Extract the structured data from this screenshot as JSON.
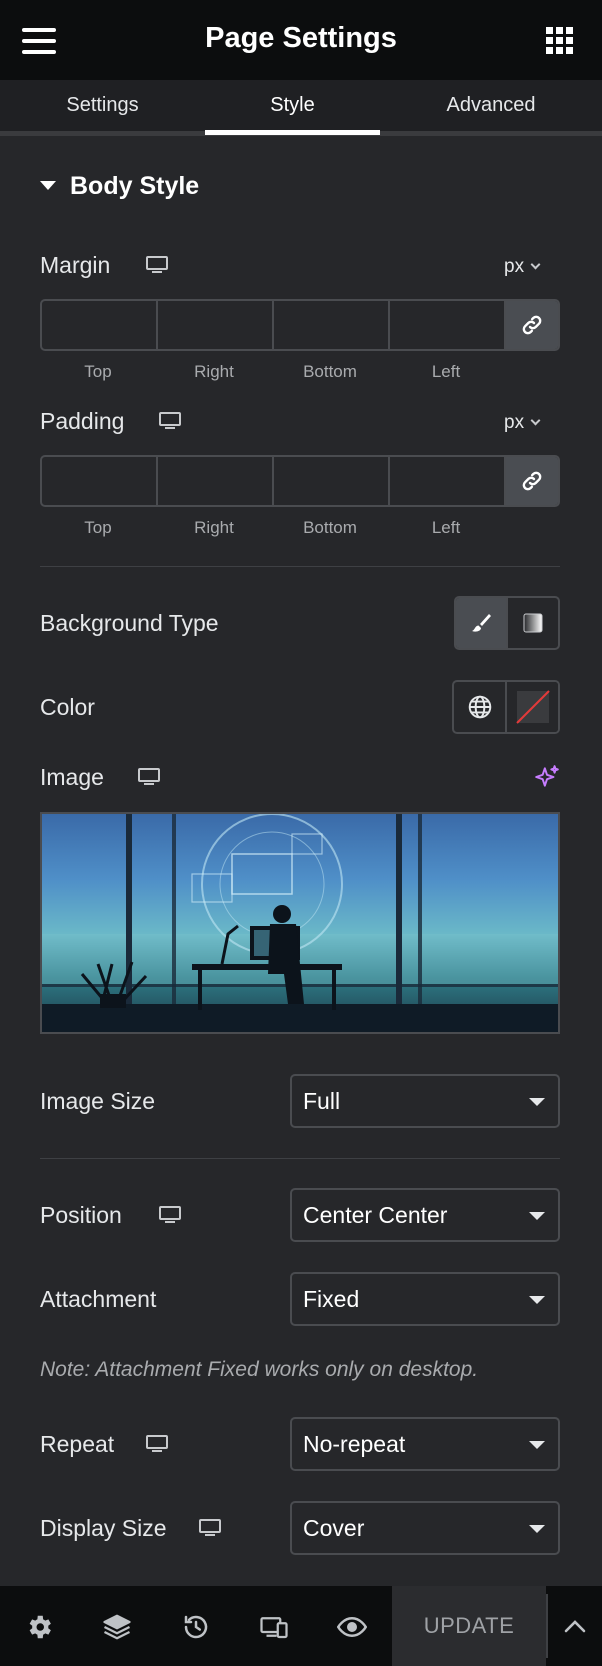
{
  "header": {
    "title": "Page Settings",
    "menu_icon": "hamburger-icon",
    "apps_icon": "grid-icon"
  },
  "tabs": [
    {
      "label": "Settings",
      "active": false
    },
    {
      "label": "Style",
      "active": true
    },
    {
      "label": "Advanced",
      "active": false
    }
  ],
  "section": {
    "title": "Body Style"
  },
  "margin": {
    "label": "Margin",
    "unit": "px",
    "values": {
      "top": "",
      "right": "",
      "bottom": "",
      "left": ""
    },
    "sides": [
      "Top",
      "Right",
      "Bottom",
      "Left"
    ]
  },
  "padding": {
    "label": "Padding",
    "unit": "px",
    "values": {
      "top": "",
      "right": "",
      "bottom": "",
      "left": ""
    },
    "sides": [
      "Top",
      "Right",
      "Bottom",
      "Left"
    ]
  },
  "background_type": {
    "label": "Background Type",
    "selected": "classic"
  },
  "color": {
    "label": "Color"
  },
  "image": {
    "label": "Image"
  },
  "image_size": {
    "label": "Image Size",
    "value": "Full"
  },
  "position": {
    "label": "Position",
    "value": "Center Center"
  },
  "attachment": {
    "label": "Attachment",
    "value": "Fixed"
  },
  "note": "Note: Attachment Fixed works only on desktop.",
  "repeat": {
    "label": "Repeat",
    "value": "No-repeat"
  },
  "display_size": {
    "label": "Display Size",
    "value": "Cover"
  },
  "footer": {
    "update_label": "UPDATE"
  },
  "colors": {
    "accent_ai": "#c77dff",
    "header_bg": "#0c0d0e",
    "panel_bg": "#26272a"
  }
}
